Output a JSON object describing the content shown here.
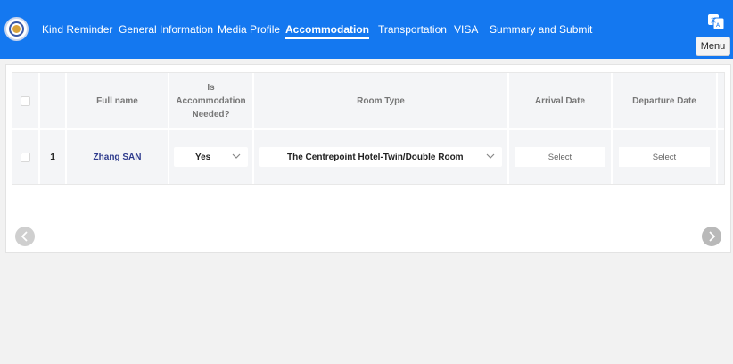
{
  "header": {
    "brand_color": "#1478f0",
    "nav": [
      {
        "label": "Kind Reminder",
        "active": false
      },
      {
        "label": "General Information",
        "active": false
      },
      {
        "label": "Media Profile",
        "active": false
      },
      {
        "label": "Accommodation",
        "active": true
      },
      {
        "label": "Transportation",
        "active": false
      },
      {
        "label": "VISA",
        "active": false
      },
      {
        "label": "Summary and Submit",
        "active": false
      }
    ],
    "menu_label": "Menu",
    "icons": {
      "logo": "emblem-logo",
      "language": "translate-icon"
    }
  },
  "table": {
    "columns": [
      "",
      "",
      "Full name",
      "Is Accommodation Needed?",
      "Room Type",
      "Arrival Date",
      "Departure Date"
    ],
    "header_lines": {
      "full_name": "Full name",
      "accommodation": [
        "Is",
        "Accommodation",
        "Needed?"
      ],
      "room_type": "Room Type",
      "arrival": "Arrival Date",
      "departure": "Departure Date"
    },
    "rows": [
      {
        "index": "1",
        "full_name": "Zhang SAN",
        "accommodation_needed": "Yes",
        "room_type": "The Centrepoint Hotel-Twin/Double Room",
        "arrival_date": "Select",
        "departure_date": "Select"
      }
    ]
  },
  "pager": {
    "prev_icon": "chevron-left-icon",
    "next_icon": "chevron-right-icon"
  }
}
